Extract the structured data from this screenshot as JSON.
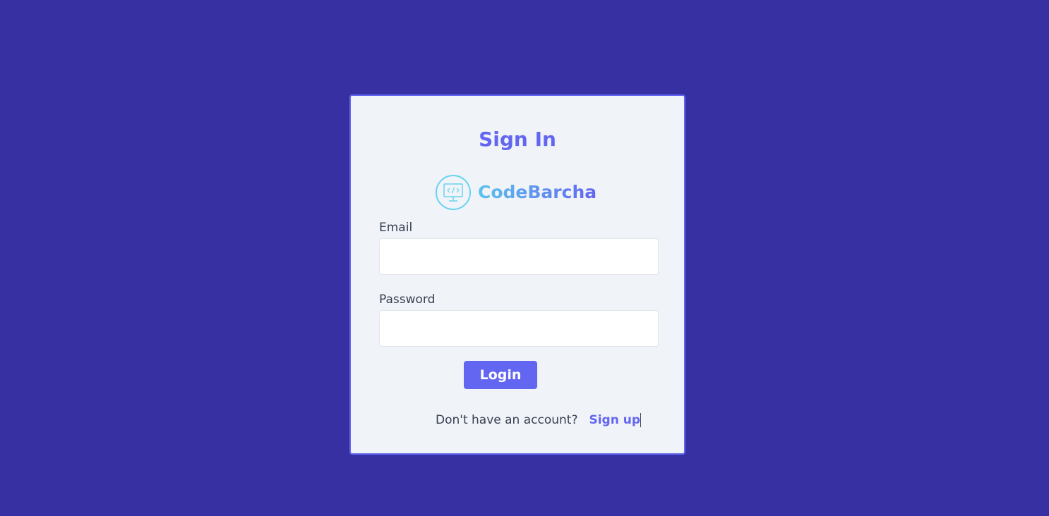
{
  "form": {
    "title": "Sign In",
    "logo_text": "CodeBarcha",
    "email_label": "Email",
    "email_value": "",
    "password_label": "Password",
    "password_value": "",
    "login_label": "Login",
    "no_account_text": "Don't have an account?",
    "signup_label": "Sign up"
  },
  "colors": {
    "background": "#3730a3",
    "accent": "#6366f1",
    "card": "#f0f3f8",
    "logo_cyan": "#67d4f0"
  },
  "icons": {
    "logo": "monitor-code-icon"
  }
}
